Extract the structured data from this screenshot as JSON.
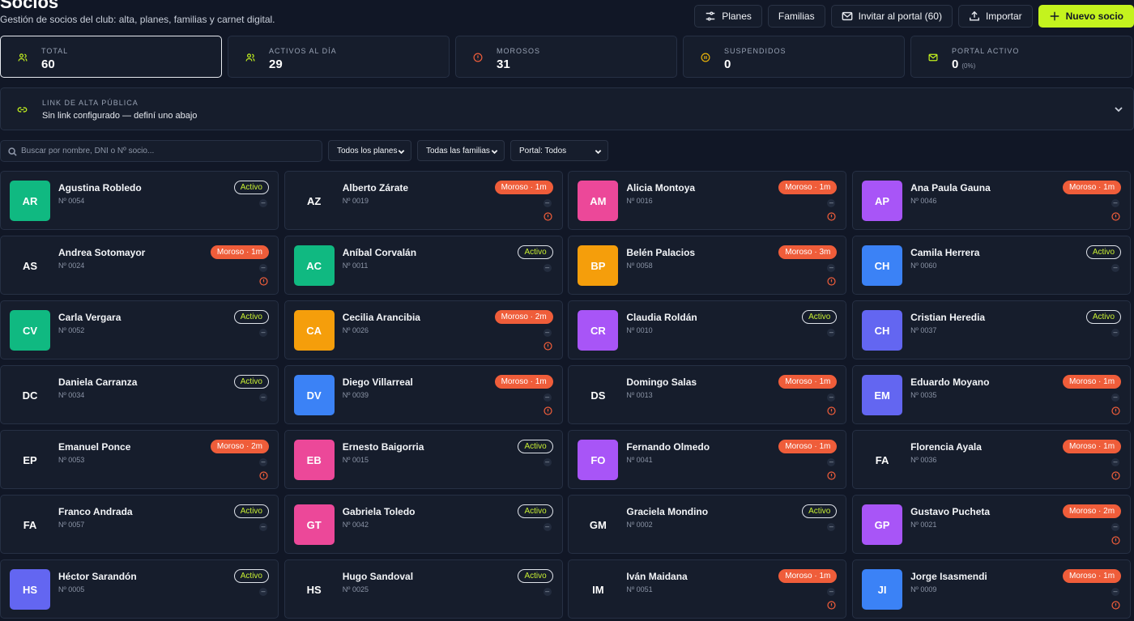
{
  "header": {
    "title": "Socios",
    "subtitle": "Gestión de socios del club: alta, planes, familias y carnet digital.",
    "actions": {
      "plans": "Planes",
      "families": "Familias",
      "invite": "Invitar al portal (60)",
      "import": "Importar",
      "new": "Nuevo socio"
    }
  },
  "stats": [
    {
      "label": "TOTAL",
      "value": "60",
      "pct": ""
    },
    {
      "label": "ACTIVOS AL DÍA",
      "value": "29",
      "pct": ""
    },
    {
      "label": "MOROSOS",
      "value": "31",
      "pct": ""
    },
    {
      "label": "SUSPENDIDOS",
      "value": "0",
      "pct": ""
    },
    {
      "label": "PORTAL ACTIVO",
      "value": "0",
      "pct": "(0%)"
    }
  ],
  "public_link": {
    "label": "LINK DE ALTA PÚBLICA",
    "text": "Sin link configurado — definí uno abajo"
  },
  "filters": {
    "search_placeholder": "Buscar por nombre, DNI o Nº socio...",
    "plans": "Todos los planes",
    "families": "Todas las familias",
    "portal": "Portal: Todos"
  },
  "colors": {
    "accent": "#c4f31e",
    "moroso": "#ef5d3a",
    "green": "#10b981",
    "pink": "#ec4899",
    "purple": "#a855f7",
    "orange": "#f59e0b",
    "blue": "#3b82f6",
    "indigo": "#6366f1"
  },
  "members": [
    {
      "initials": "AR",
      "name": "Agustina Robledo",
      "num": "Nº 0054",
      "status": "Activo",
      "color": "green",
      "warn": false
    },
    {
      "initials": "AZ",
      "name": "Alberto Zárate",
      "num": "Nº 0019",
      "status": "Moroso · 1m",
      "color": "",
      "warn": true
    },
    {
      "initials": "AM",
      "name": "Alicia Montoya",
      "num": "Nº 0016",
      "status": "Moroso · 1m",
      "color": "pink",
      "warn": true
    },
    {
      "initials": "AP",
      "name": "Ana Paula Gauna",
      "num": "Nº 0046",
      "status": "Moroso · 1m",
      "color": "purple",
      "warn": true
    },
    {
      "initials": "AS",
      "name": "Andrea Sotomayor",
      "num": "Nº 0024",
      "status": "Moroso · 1m",
      "color": "",
      "warn": true
    },
    {
      "initials": "AC",
      "name": "Aníbal Corvalán",
      "num": "Nº 0011",
      "status": "Activo",
      "color": "green",
      "warn": false
    },
    {
      "initials": "BP",
      "name": "Belén Palacios",
      "num": "Nº 0058",
      "status": "Moroso · 3m",
      "color": "orange",
      "warn": true
    },
    {
      "initials": "CH",
      "name": "Camila Herrera",
      "num": "Nº 0060",
      "status": "Activo",
      "color": "blue",
      "warn": false
    },
    {
      "initials": "CV",
      "name": "Carla Vergara",
      "num": "Nº 0052",
      "status": "Activo",
      "color": "green",
      "warn": false
    },
    {
      "initials": "CA",
      "name": "Cecilia Arancibia",
      "num": "Nº 0026",
      "status": "Moroso · 2m",
      "color": "orange",
      "warn": true
    },
    {
      "initials": "CR",
      "name": "Claudia Roldán",
      "num": "Nº 0010",
      "status": "Activo",
      "color": "purple",
      "warn": false
    },
    {
      "initials": "CH",
      "name": "Cristian Heredia",
      "num": "Nº 0037",
      "status": "Activo",
      "color": "indigo",
      "warn": false
    },
    {
      "initials": "DC",
      "name": "Daniela Carranza",
      "num": "Nº 0034",
      "status": "Activo",
      "color": "",
      "warn": false
    },
    {
      "initials": "DV",
      "name": "Diego Villarreal",
      "num": "Nº 0039",
      "status": "Moroso · 1m",
      "color": "blue",
      "warn": true
    },
    {
      "initials": "DS",
      "name": "Domingo Salas",
      "num": "Nº 0013",
      "status": "Moroso · 1m",
      "color": "",
      "warn": true
    },
    {
      "initials": "EM",
      "name": "Eduardo Moyano",
      "num": "Nº 0035",
      "status": "Moroso · 1m",
      "color": "indigo",
      "warn": true
    },
    {
      "initials": "EP",
      "name": "Emanuel Ponce",
      "num": "Nº 0053",
      "status": "Moroso · 2m",
      "color": "",
      "warn": true
    },
    {
      "initials": "EB",
      "name": "Ernesto Baigorria",
      "num": "Nº 0015",
      "status": "Activo",
      "color": "pink",
      "warn": false
    },
    {
      "initials": "FO",
      "name": "Fernando Olmedo",
      "num": "Nº 0041",
      "status": "Moroso · 1m",
      "color": "purple",
      "warn": true
    },
    {
      "initials": "FA",
      "name": "Florencia Ayala",
      "num": "Nº 0036",
      "status": "Moroso · 1m",
      "color": "",
      "warn": true
    },
    {
      "initials": "FA",
      "name": "Franco Andrada",
      "num": "Nº 0057",
      "status": "Activo",
      "color": "",
      "warn": false
    },
    {
      "initials": "GT",
      "name": "Gabriela Toledo",
      "num": "Nº 0042",
      "status": "Activo",
      "color": "pink",
      "warn": false
    },
    {
      "initials": "GM",
      "name": "Graciela Mondino",
      "num": "Nº 0002",
      "status": "Activo",
      "color": "",
      "warn": false
    },
    {
      "initials": "GP",
      "name": "Gustavo Pucheta",
      "num": "Nº 0021",
      "status": "Moroso · 2m",
      "color": "purple",
      "warn": true
    },
    {
      "initials": "HS",
      "name": "Héctor Sarandón",
      "num": "Nº 0005",
      "status": "Activo",
      "color": "indigo",
      "warn": false
    },
    {
      "initials": "HS",
      "name": "Hugo Sandoval",
      "num": "Nº 0025",
      "status": "Activo",
      "color": "",
      "warn": false
    },
    {
      "initials": "IM",
      "name": "Iván Maidana",
      "num": "Nº 0051",
      "status": "Moroso · 1m",
      "color": "",
      "warn": true
    },
    {
      "initials": "JI",
      "name": "Jorge Isasmendi",
      "num": "Nº 0009",
      "status": "Moroso · 1m",
      "color": "blue",
      "warn": true
    }
  ]
}
